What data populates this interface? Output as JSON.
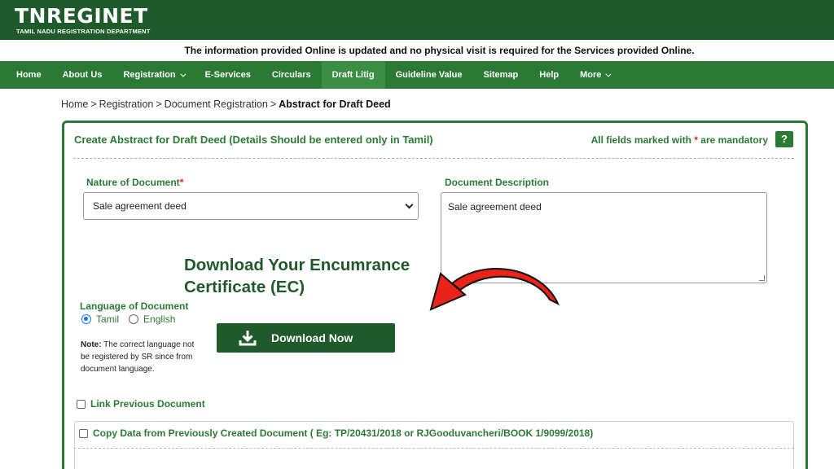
{
  "header": {
    "logo": "TNREGINET",
    "subtitle": "TAMIL NADU REGISTRATION DEPARTMENT",
    "bg_color": "#1f5a2a"
  },
  "notice": "The information provided Online is updated and no physical visit is required for the Services provided Online.",
  "nav": {
    "items": [
      {
        "label": "Home"
      },
      {
        "label": "About Us"
      },
      {
        "label": "Registration"
      },
      {
        "label": "E-Services"
      },
      {
        "label": "Circulars"
      },
      {
        "label": "Draft Litig"
      },
      {
        "label": "Guideline Value"
      },
      {
        "label": "Sitemap"
      },
      {
        "label": "Help"
      },
      {
        "label": "More"
      }
    ],
    "bg_color": "#2b7a34"
  },
  "breadcrumb": {
    "items": [
      "Home",
      "Registration",
      "Document Registration"
    ],
    "separator": ">",
    "current": "Abstract for Draft Deed"
  },
  "form": {
    "title": "Create Abstract for Draft Deed (Details Should be entered only in Tamil)",
    "mandatory_prefix": "All fields marked with",
    "mandatory_star": "*",
    "mandatory_suffix": "are mandatory",
    "help_label": "?",
    "nature_label": "Nature of Document",
    "nature_value": "Sale agreement deed",
    "description_label": "Document Description",
    "description_value": "Sale agreement deed",
    "language_label": "Language of Document",
    "language_options": [
      "Tamil",
      "English"
    ],
    "language_selected": "Tamil",
    "note_bold": "Note:",
    "note_text": "The correct language not be registered by SR since from document language.",
    "link_previous_label": "Link Previous Document",
    "copy_data_label": "Copy Data from Previously Created Document ( Eg: TP/20431/2018 or RJGooduvancheri/BOOK 1/9099/2018)"
  },
  "promo": {
    "line1": "Download Your Encumrance",
    "line2": "Certificate (EC)",
    "button_label": "Download Now",
    "arrow_color": "#e8231a"
  }
}
